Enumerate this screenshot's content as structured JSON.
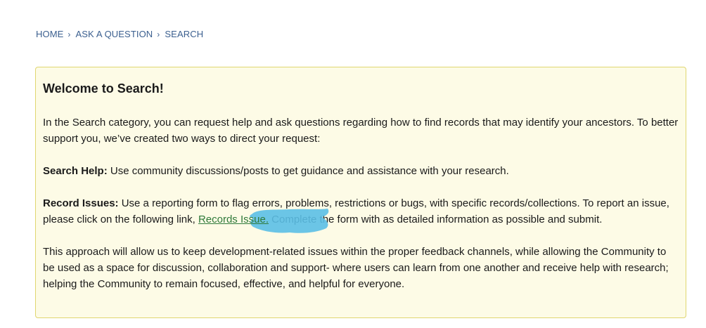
{
  "breadcrumb": {
    "items": [
      "HOME",
      "ASK A QUESTION",
      "SEARCH"
    ],
    "separator": "›"
  },
  "notice": {
    "title": "Welcome to Search!",
    "intro": "In the Search category, you can request help and ask questions regarding how to find records that may identify your ancestors. To better support you, we’ve created two ways to direct your request:",
    "search_help_label": "Search Help:",
    "search_help_text": " Use community discussions/posts to get guidance and assistance with your research.",
    "record_issues_label": "Record Issues:",
    "record_issues_text_before": " Use a reporting form to flag errors, problems, restrictions or bugs, with specific records/collections. To report an issue, please click on the following link, ",
    "record_issues_link": "Records Issue.",
    "record_issues_text_after": " Complete the form with as detailed information as possible and submit.",
    "approach": "This approach will allow us to keep development-related issues within the proper feedback channels, while allowing the Community to be used as a space for discussion, collaboration and support- where users can learn from one another and receive help with research; helping the Community to remain focused, effective, and helpful for everyone."
  },
  "colors": {
    "breadcrumb": "#3b5f8f",
    "notice_background": "#fdfbe6",
    "notice_border": "#e0d670",
    "link": "#2f7a3a",
    "highlight": "#5bbfe6"
  }
}
